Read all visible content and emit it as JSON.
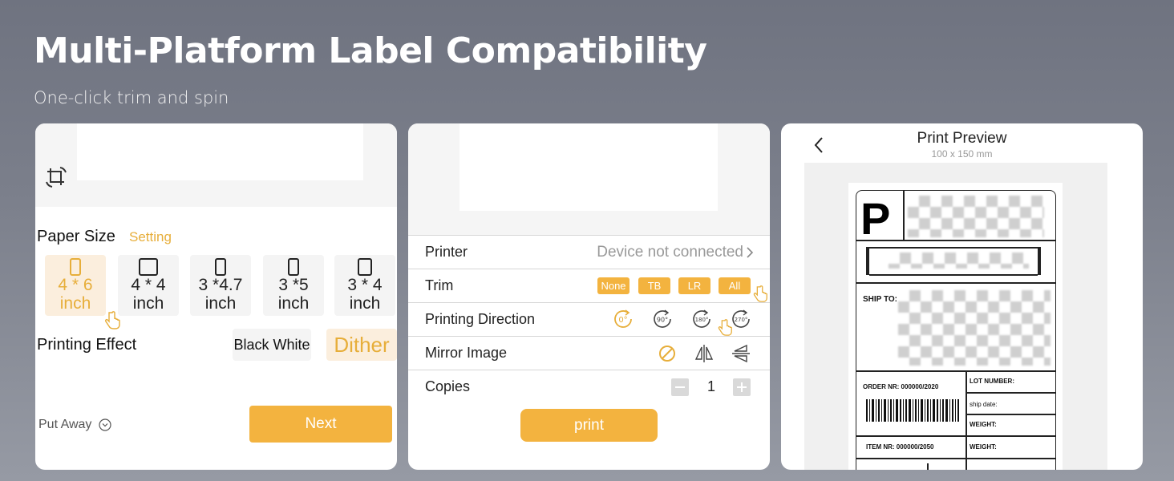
{
  "hero": {
    "title": "Multi-Platform Label Compatibility",
    "subtitle": "One-click trim and spin"
  },
  "panel1": {
    "crop_icon": "crop-rotate-icon",
    "paper_size_label": "Paper Size",
    "setting_link": "Setting",
    "sizes": [
      {
        "line1": "4 * 6",
        "line2": "inch",
        "selected": true
      },
      {
        "line1": "4 * 4",
        "line2": "inch",
        "selected": false
      },
      {
        "line1": "3 *4.7",
        "line2": "inch",
        "selected": false
      },
      {
        "line1": "3 *5",
        "line2": "inch",
        "selected": false
      },
      {
        "line1": "3 * 4",
        "line2": "inch",
        "selected": false
      }
    ],
    "printing_effect_label": "Printing Effect",
    "effect_black_white": "Black White",
    "effect_dither": "Dither",
    "selected_effect": "Dither",
    "put_away": "Put Away",
    "next": "Next"
  },
  "panel2": {
    "printer_label": "Printer",
    "printer_status": "Device not connected",
    "trim_label": "Trim",
    "trim_options": [
      "None",
      "TB",
      "LR",
      "All"
    ],
    "direction_label": "Printing Direction",
    "direction_options": [
      "0°",
      "90°",
      "180°",
      "270°"
    ],
    "mirror_label": "Mirror Image",
    "copies_label": "Copies",
    "copies_value": "1",
    "print": "print"
  },
  "panel3": {
    "title": "Print Preview",
    "size": "100 x 150 mm",
    "label": {
      "big_letter": "P",
      "ship_to": "SHIP TO:",
      "order_nr": "ORDER NR: 000000/2020",
      "lot_number": "LOT NUMBER:",
      "ship_date": "ship date:",
      "weight1": "WEIGHT:",
      "item_nr": "ITEM NR: 000000/2050",
      "weight2": "WEIGHT:"
    }
  },
  "colors": {
    "accent": "#f3b33f",
    "accent_light": "#fbeedd",
    "background": "#7b7f8b"
  }
}
